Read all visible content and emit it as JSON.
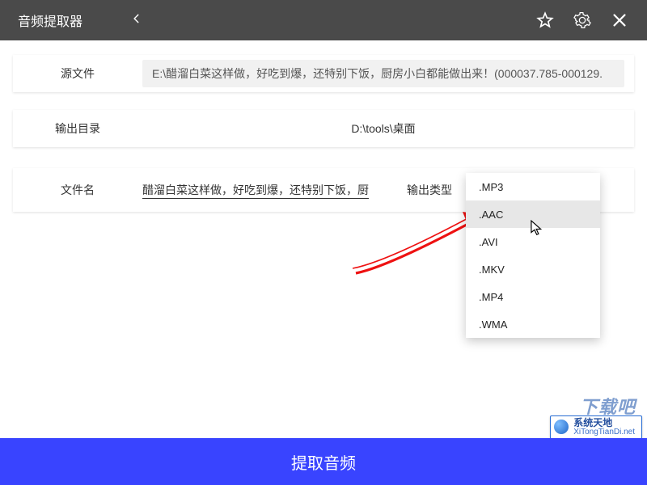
{
  "header": {
    "title": "音频提取器"
  },
  "source": {
    "label": "源文件",
    "value": "E:\\醋溜白菜这样做，好吃到爆，还特别下饭，厨房小白都能做出来！(000037.785-000129."
  },
  "output": {
    "label": "输出目录",
    "value": "D:\\tools\\桌面"
  },
  "file": {
    "name_label": "文件名",
    "name_value": "醋溜白菜这样做，好吃到爆，还特别下饭，厨房小白",
    "type_label": "输出类型"
  },
  "formats": [
    ".MP3",
    ".AAC",
    ".AVI",
    ".MKV",
    ".MP4",
    ".WMA"
  ],
  "hover_index": 1,
  "action_button": "提取音频",
  "watermark": {
    "name": "系统天地",
    "url": "XiTongTianDi.net",
    "bgtext": "下载吧"
  }
}
